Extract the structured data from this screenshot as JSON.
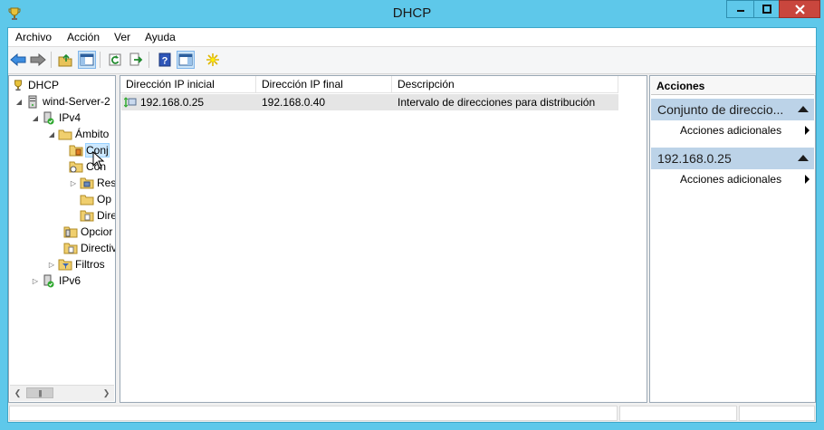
{
  "window": {
    "title": "DHCP",
    "app_icon": "dhcp-trophy-icon"
  },
  "menu": [
    "Archivo",
    "Acción",
    "Ver",
    "Ayuda"
  ],
  "toolbar": [
    "back-arrow-icon",
    "forward-arrow-icon",
    "up-folder-icon",
    "show-hide-tree-icon",
    "refresh-icon",
    "export-list-icon",
    "help-icon",
    "show-action-pane-icon",
    "new-object-star-icon"
  ],
  "tree": {
    "root": "DHCP",
    "server": "wind-Server-2",
    "ipv4": "IPv4",
    "ambito": "Ámbito",
    "conjunto": "Conj",
    "concesiones": "Con",
    "reservas": "Res",
    "opciones_ambito": "Op",
    "directivas_ambito": "Dire",
    "opciones_servidor": "Opcior",
    "directivas": "Directiv",
    "filtros": "Filtros",
    "ipv6": "IPv6"
  },
  "list": {
    "columns": [
      "Dirección IP inicial",
      "Dirección IP final",
      "Descripción"
    ],
    "rows": [
      {
        "start_ip": "192.168.0.25",
        "end_ip": "192.168.0.40",
        "description": "Intervalo de direcciones para distribución"
      }
    ]
  },
  "actions": {
    "header": "Acciones",
    "sections": [
      {
        "title": "Conjunto de direccio...",
        "item": "Acciones adicionales"
      },
      {
        "title": "192.168.0.25",
        "item": "Acciones adicionales"
      }
    ]
  },
  "colors": {
    "title_bar": "#5ec8ea",
    "close_button": "#c9463d",
    "selection": "#cce8ff",
    "section_header": "#bcd3e8"
  }
}
